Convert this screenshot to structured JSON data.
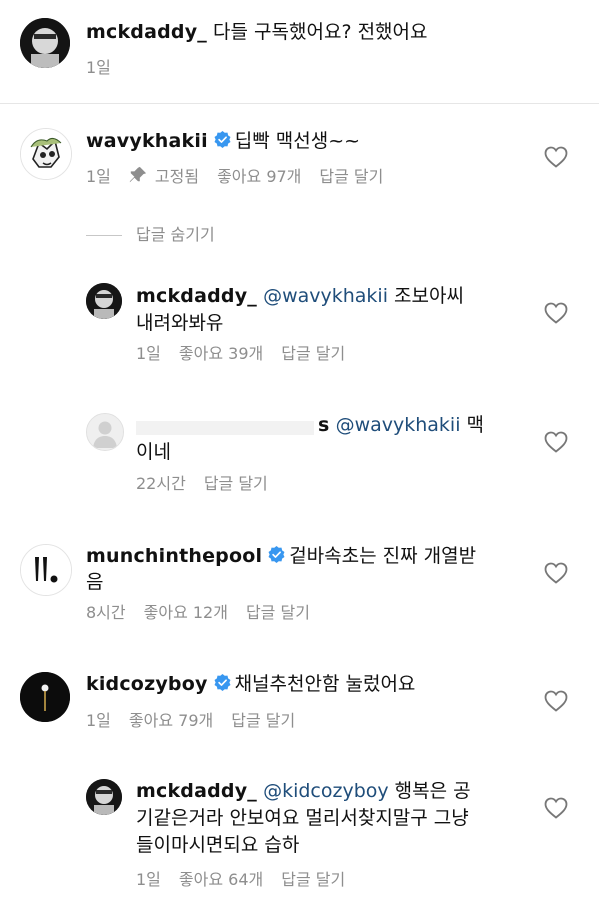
{
  "comments": [
    {
      "username": "mckdaddy_",
      "text": " 다들 구독했어요? 전했어요",
      "time": "1일"
    },
    {
      "username": "wavykhakii",
      "text": "딥빡 맥선생~~",
      "time": "1일",
      "pinned": "고정됨",
      "likes": "좋아요 97개",
      "reply": "답글 달기",
      "hide_replies": "답글 숨기기",
      "replies": [
        {
          "username": "mckdaddy_",
          "mention": "@wavykhakii",
          "text_line1": " 조보아씨",
          "text_line2": "내려와봐유",
          "time": "1일",
          "likes": "좋아요 39개",
          "reply": "답글 달기"
        },
        {
          "username_partial": "s",
          "mention": "@wavykhakii",
          "text_line1": " 맥",
          "text_line2": "이네",
          "time": "22시간",
          "reply": "답글 달기"
        }
      ]
    },
    {
      "username": "munchinthepool",
      "text_line1": "겉바속초는 진짜 개열받",
      "text_line2": "음",
      "time": "8시간",
      "likes": "좋아요 12개",
      "reply": "답글 달기"
    },
    {
      "username": "kidcozyboy",
      "text": "채널추천안함 눌렀어요",
      "time": "1일",
      "likes": "좋아요 79개",
      "reply": "답글 달기",
      "replies": [
        {
          "username": "mckdaddy_",
          "mention": "@kidcozyboy",
          "text_line1": " 행복은 공",
          "text_line2": "기같은거라 안보여요 멀리서찾지말구 그냥",
          "text_line3": "들이마시면되요 습하",
          "time": "1일",
          "likes": "좋아요 64개",
          "reply": "답글 달기"
        }
      ]
    }
  ],
  "colors": {
    "mention": "#1f4d7a",
    "meta": "#8e8e8e",
    "verified": "#3897f0"
  }
}
